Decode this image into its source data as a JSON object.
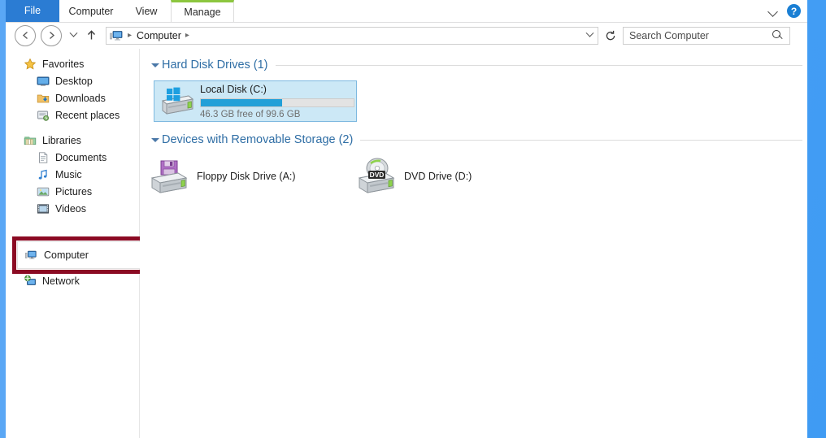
{
  "window": {
    "title": "Computer"
  },
  "ribbon": {
    "tabs": [
      {
        "label": "File",
        "name": "tab-file"
      },
      {
        "label": "Computer",
        "name": "tab-computer"
      },
      {
        "label": "View",
        "name": "tab-view"
      },
      {
        "label": "Manage",
        "name": "tab-manage",
        "accent_color": "#8cc63f"
      }
    ],
    "collapse_icon": "chevron-down-icon",
    "help_icon": "help-icon",
    "help_label": "?",
    "file_tab_color": "#2b7cd3"
  },
  "toolbar": {
    "back_label": "←",
    "forward_label": "→",
    "recent_label": "",
    "up_label": "↑",
    "refresh_label": "↻"
  },
  "breadcrumb": {
    "icon": "computer-icon",
    "separator": "▸",
    "items": [
      "Computer"
    ],
    "path_text": "Computer"
  },
  "search": {
    "placeholder": "Search Computer",
    "value": "",
    "icon": "search-icon"
  },
  "sidebar": {
    "groups": [
      {
        "label": "Favorites",
        "icon": "star-icon",
        "items": [
          {
            "label": "Desktop",
            "icon": "desktop-icon"
          },
          {
            "label": "Downloads",
            "icon": "downloads-icon"
          },
          {
            "label": "Recent places",
            "icon": "recent-places-icon"
          }
        ]
      },
      {
        "label": "Libraries",
        "icon": "libraries-icon",
        "items": [
          {
            "label": "Documents",
            "icon": "document-icon"
          },
          {
            "label": "Music",
            "icon": "music-icon"
          },
          {
            "label": "Pictures",
            "icon": "pictures-icon"
          },
          {
            "label": "Videos",
            "icon": "videos-icon"
          }
        ]
      }
    ],
    "computer": {
      "label": "Computer",
      "icon": "computer-icon",
      "highlight_color": "#8b0a23"
    },
    "network": {
      "label": "Network",
      "icon": "network-icon"
    }
  },
  "main": {
    "sections": [
      {
        "title": "Hard Disk Drives (1)",
        "collapsed": false
      },
      {
        "title": "Devices with Removable Storage (2)",
        "collapsed": false
      }
    ],
    "hard_drives": [
      {
        "name": "Local Disk (C:)",
        "capacity_text": "46.3 GB free of 99.6 GB",
        "free_gb": 46.3,
        "total_gb": 99.6,
        "used_percent": 53,
        "selected": true,
        "icon": "hard-drive-icon",
        "bar_color": "#22a0d8"
      }
    ],
    "removable": [
      {
        "name": "Floppy Disk Drive (A:)",
        "icon": "floppy-drive-icon"
      },
      {
        "name": "DVD Drive (D:)",
        "icon": "dvd-drive-icon",
        "badge": "DVD"
      }
    ]
  }
}
